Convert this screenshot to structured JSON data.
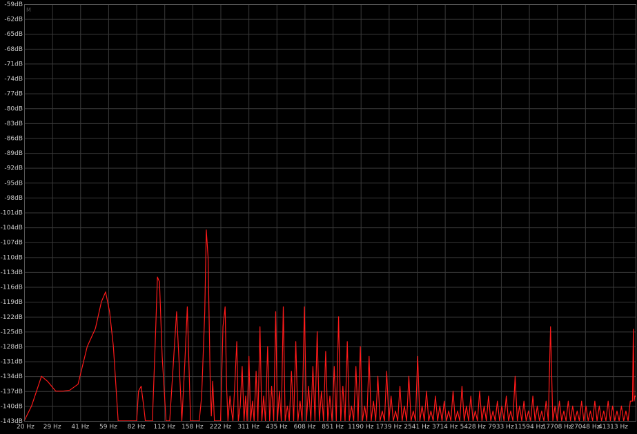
{
  "chart_data": {
    "type": "line",
    "corner_marker": "M",
    "series_color": "#ff1a1a",
    "grid_color": "#3a3a3a",
    "background": "#000000",
    "grid": true,
    "ylim": [
      -143,
      -59
    ],
    "y_ticks": [
      "-59dB",
      "-62dB",
      "-65dB",
      "-68dB",
      "-71dB",
      "-74dB",
      "-77dB",
      "-80dB",
      "-83dB",
      "-86dB",
      "-89dB",
      "-92dB",
      "-95dB",
      "-98dB",
      "-101dB",
      "-104dB",
      "-107dB",
      "-110dB",
      "-113dB",
      "-116dB",
      "-119dB",
      "-122dB",
      "-125dB",
      "-128dB",
      "-131dB",
      "-134dB",
      "-137dB",
      "-140dB",
      "-143dB"
    ],
    "x_ticks": [
      "20 Hz",
      "29 Hz",
      "41 Hz",
      "59 Hz",
      "82 Hz",
      "112 Hz",
      "158 Hz",
      "222 Hz",
      "311 Hz",
      "435 Hz",
      "608 Hz",
      "851 Hz",
      "1190 Hz",
      "1739 Hz",
      "2541 Hz",
      "3714 Hz",
      "5428 Hz",
      "7933 Hz",
      "11594 Hz",
      "17708 Hz",
      "27048 Hz",
      "41313 Hz"
    ],
    "x_scale": "log",
    "xlim_hz": [
      20,
      52000
    ],
    "points": [
      [
        20,
        -143
      ],
      [
        22,
        -140
      ],
      [
        25,
        -134
      ],
      [
        27,
        -135
      ],
      [
        30,
        -137
      ],
      [
        33,
        -137
      ],
      [
        36,
        -136.8
      ],
      [
        40,
        -135.6
      ],
      [
        45,
        -128
      ],
      [
        50,
        -124.4
      ],
      [
        54,
        -119
      ],
      [
        57,
        -117
      ],
      [
        60,
        -121
      ],
      [
        63,
        -128
      ],
      [
        67,
        -143
      ],
      [
        85,
        -143
      ],
      [
        87,
        -137
      ],
      [
        90,
        -136
      ],
      [
        93,
        -140
      ],
      [
        95,
        -143
      ],
      [
        104,
        -143
      ],
      [
        108,
        -127
      ],
      [
        111,
        -114
      ],
      [
        114,
        -115
      ],
      [
        118,
        -130
      ],
      [
        124,
        -143
      ],
      [
        130,
        -143
      ],
      [
        137,
        -130
      ],
      [
        142,
        -121
      ],
      [
        147,
        -132
      ],
      [
        152,
        -143
      ],
      [
        158,
        -131
      ],
      [
        163,
        -120
      ],
      [
        170,
        -143
      ],
      [
        190,
        -143
      ],
      [
        196,
        -138
      ],
      [
        204,
        -121
      ],
      [
        208,
        -104.5
      ],
      [
        213,
        -110
      ],
      [
        219,
        -136
      ],
      [
        222,
        -142
      ],
      [
        226,
        -135
      ],
      [
        231,
        -143
      ],
      [
        250,
        -143
      ],
      [
        258,
        -124
      ],
      [
        265,
        -120
      ],
      [
        270,
        -136
      ],
      [
        275,
        -143
      ],
      [
        282,
        -138
      ],
      [
        288,
        -141
      ],
      [
        293,
        -143
      ],
      [
        300,
        -136
      ],
      [
        308,
        -127
      ],
      [
        314,
        -143
      ],
      [
        322,
        -140
      ],
      [
        330,
        -132
      ],
      [
        338,
        -143
      ],
      [
        345,
        -138
      ],
      [
        352,
        -143
      ],
      [
        360,
        -130
      ],
      [
        368,
        -143
      ],
      [
        377,
        -139
      ],
      [
        385,
        -143
      ],
      [
        395,
        -133
      ],
      [
        404,
        -143
      ],
      [
        415,
        -124
      ],
      [
        425,
        -143
      ],
      [
        435,
        -138
      ],
      [
        445,
        -143
      ],
      [
        458,
        -128
      ],
      [
        470,
        -143
      ],
      [
        482,
        -136
      ],
      [
        495,
        -143
      ],
      [
        508,
        -121
      ],
      [
        520,
        -143
      ],
      [
        533,
        -137
      ],
      [
        546,
        -143
      ],
      [
        560,
        -120
      ],
      [
        574,
        -143
      ],
      [
        590,
        -140
      ],
      [
        605,
        -143
      ],
      [
        622,
        -133
      ],
      [
        640,
        -143
      ],
      [
        658,
        -127
      ],
      [
        676,
        -143
      ],
      [
        695,
        -139
      ],
      [
        714,
        -143
      ],
      [
        735,
        -120
      ],
      [
        755,
        -143
      ],
      [
        775,
        -136
      ],
      [
        798,
        -143
      ],
      [
        820,
        -132
      ],
      [
        842,
        -143
      ],
      [
        866,
        -125
      ],
      [
        890,
        -143
      ],
      [
        915,
        -137
      ],
      [
        940,
        -143
      ],
      [
        966,
        -129
      ],
      [
        992,
        -143
      ],
      [
        1020,
        -138
      ],
      [
        1048,
        -143
      ],
      [
        1078,
        -132
      ],
      [
        1108,
        -143
      ],
      [
        1140,
        -122
      ],
      [
        1172,
        -143
      ],
      [
        1205,
        -136
      ],
      [
        1240,
        -143
      ],
      [
        1275,
        -127
      ],
      [
        1310,
        -143
      ],
      [
        1348,
        -140
      ],
      [
        1385,
        -143
      ],
      [
        1425,
        -132
      ],
      [
        1466,
        -143
      ],
      [
        1508,
        -128
      ],
      [
        1550,
        -143
      ],
      [
        1595,
        -140
      ],
      [
        1640,
        -143
      ],
      [
        1688,
        -130
      ],
      [
        1736,
        -143
      ],
      [
        1786,
        -139
      ],
      [
        1838,
        -143
      ],
      [
        1890,
        -134
      ],
      [
        1945,
        -143
      ],
      [
        2000,
        -141
      ],
      [
        2058,
        -143
      ],
      [
        2117,
        -133
      ],
      [
        2178,
        -143
      ],
      [
        2240,
        -138
      ],
      [
        2305,
        -143
      ],
      [
        2372,
        -141
      ],
      [
        2440,
        -143
      ],
      [
        2510,
        -136
      ],
      [
        2583,
        -143
      ],
      [
        2658,
        -140
      ],
      [
        2735,
        -143
      ],
      [
        2814,
        -134
      ],
      [
        2895,
        -143
      ],
      [
        2979,
        -141
      ],
      [
        3065,
        -143
      ],
      [
        3153,
        -130
      ],
      [
        3244,
        -143
      ],
      [
        3338,
        -140
      ],
      [
        3434,
        -143
      ],
      [
        3534,
        -137
      ],
      [
        3636,
        -143
      ],
      [
        3741,
        -141
      ],
      [
        3849,
        -143
      ],
      [
        3960,
        -138
      ],
      [
        4074,
        -143
      ],
      [
        4192,
        -140
      ],
      [
        4313,
        -143
      ],
      [
        4437,
        -139
      ],
      [
        4566,
        -143
      ],
      [
        4698,
        -141
      ],
      [
        4833,
        -143
      ],
      [
        4973,
        -137
      ],
      [
        5117,
        -143
      ],
      [
        5265,
        -141
      ],
      [
        5417,
        -143
      ],
      [
        5573,
        -136
      ],
      [
        5734,
        -143
      ],
      [
        5900,
        -140
      ],
      [
        6070,
        -143
      ],
      [
        6246,
        -138
      ],
      [
        6426,
        -143
      ],
      [
        6612,
        -141
      ],
      [
        6803,
        -143
      ],
      [
        7000,
        -137
      ],
      [
        7202,
        -143
      ],
      [
        7410,
        -140
      ],
      [
        7624,
        -143
      ],
      [
        7844,
        -138
      ],
      [
        8071,
        -143
      ],
      [
        8304,
        -141
      ],
      [
        8544,
        -143
      ],
      [
        8791,
        -139
      ],
      [
        9045,
        -143
      ],
      [
        9306,
        -140
      ],
      [
        9575,
        -143
      ],
      [
        9852,
        -138
      ],
      [
        10137,
        -143
      ],
      [
        10430,
        -141
      ],
      [
        10731,
        -143
      ],
      [
        11041,
        -134
      ],
      [
        11360,
        -143
      ],
      [
        11688,
        -140
      ],
      [
        12026,
        -143
      ],
      [
        12373,
        -139
      ],
      [
        12731,
        -143
      ],
      [
        13099,
        -141
      ],
      [
        13477,
        -143
      ],
      [
        13867,
        -138
      ],
      [
        14267,
        -143
      ],
      [
        14680,
        -140
      ],
      [
        15104,
        -143
      ],
      [
        15540,
        -141
      ],
      [
        15989,
        -143
      ],
      [
        16451,
        -139
      ],
      [
        16926,
        -143
      ],
      [
        17415,
        -124
      ],
      [
        17918,
        -143
      ],
      [
        18436,
        -140
      ],
      [
        18968,
        -143
      ],
      [
        19517,
        -139
      ],
      [
        20080,
        -143
      ],
      [
        20661,
        -141
      ],
      [
        21258,
        -143
      ],
      [
        21872,
        -139
      ],
      [
        22504,
        -143
      ],
      [
        23154,
        -140
      ],
      [
        23823,
        -143
      ],
      [
        24511,
        -141
      ],
      [
        25220,
        -143
      ],
      [
        25948,
        -139
      ],
      [
        26698,
        -143
      ],
      [
        27469,
        -140
      ],
      [
        28263,
        -143
      ],
      [
        29080,
        -141
      ],
      [
        29920,
        -143
      ],
      [
        30784,
        -139
      ],
      [
        31674,
        -143
      ],
      [
        32589,
        -140
      ],
      [
        33531,
        -143
      ],
      [
        34500,
        -141
      ],
      [
        35497,
        -143
      ],
      [
        36522,
        -139
      ],
      [
        37578,
        -143
      ],
      [
        38663,
        -140
      ],
      [
        39781,
        -143
      ],
      [
        40930,
        -141
      ],
      [
        42113,
        -143
      ],
      [
        43330,
        -140
      ],
      [
        44582,
        -143
      ],
      [
        45870,
        -141
      ],
      [
        47196,
        -143
      ],
      [
        48559,
        -139
      ],
      [
        49962,
        -139
      ],
      [
        50500,
        -124.5
      ],
      [
        51000,
        -139
      ],
      [
        51500,
        -138
      ],
      [
        52000,
        -138
      ]
    ]
  }
}
